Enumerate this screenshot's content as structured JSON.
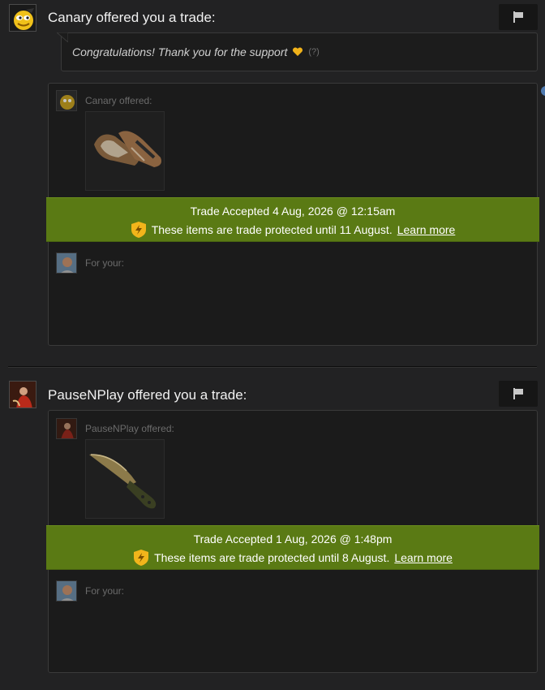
{
  "trades": [
    {
      "sender": "Canary",
      "heading": "Canary offered you a trade:",
      "message": "Congratulations! Thank you for the support",
      "message_help": "(?)",
      "offered_label": "Canary offered:",
      "item_icon": "gloves-icon",
      "accepted_text": "Trade Accepted 4 Aug, 2026 @ 12:15am",
      "protected_text": "These items are trade protected until 11 August.",
      "learn_more": "Learn more",
      "for_your_label": "For your:"
    },
    {
      "sender": "PauseNPlay",
      "heading": "PauseNPlay offered you a trade:",
      "offered_label": "PauseNPlay offered:",
      "item_icon": "knife-icon",
      "accepted_text": "Trade Accepted 1 Aug, 2026 @ 1:48pm",
      "protected_text": "These items are trade protected until 8 August.",
      "learn_more": "Learn more",
      "for_your_label": "For your:"
    }
  ],
  "colors": {
    "banner": "#5a7a14",
    "background": "#222223",
    "panel": "#1b1b1b",
    "shield": "#f2b51b"
  }
}
